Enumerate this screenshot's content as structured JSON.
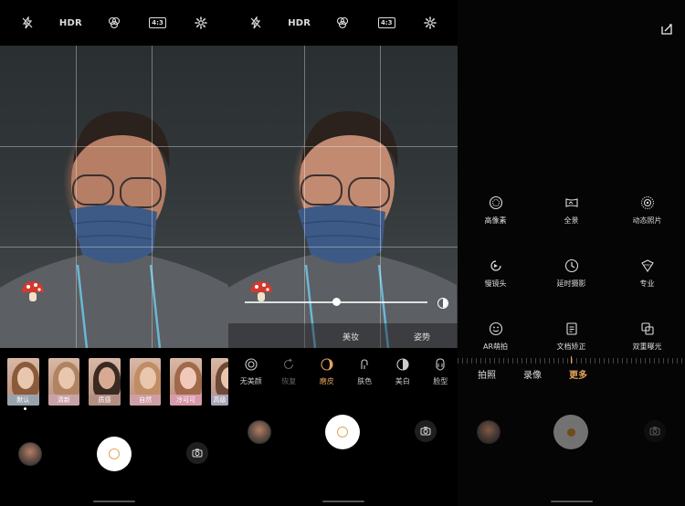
{
  "topbar": {
    "hdr_label": "HDR",
    "ratio_label": "4:3"
  },
  "panel1": {
    "filters": [
      {
        "label": "默认",
        "color": "#9aa3ad"
      },
      {
        "label": "清新",
        "color": "#c9a2a8"
      },
      {
        "label": "质感",
        "color": "#b28f84"
      },
      {
        "label": "自然",
        "color": "#cf9fa6"
      },
      {
        "label": "冷可可",
        "color": "#d79aa9"
      },
      {
        "label": "高级",
        "color": "#a9a4b8"
      }
    ]
  },
  "panel2": {
    "slider_value": 0.5,
    "tabs": [
      "美妆",
      "姿势"
    ],
    "items": [
      {
        "label": "无美颜",
        "state": "normal"
      },
      {
        "label": "恢复",
        "state": "dim"
      },
      {
        "label": "磨皮",
        "state": "active"
      },
      {
        "label": "肤色",
        "state": "normal"
      },
      {
        "label": "美白",
        "state": "normal"
      },
      {
        "label": "脸型",
        "state": "normal"
      }
    ]
  },
  "panel3": {
    "modes": [
      {
        "label": "高像素",
        "icon": "high-pixel-icon"
      },
      {
        "label": "全景",
        "icon": "panorama-icon"
      },
      {
        "label": "动态照片",
        "icon": "live-photo-icon"
      },
      {
        "label": "慢镜头",
        "icon": "slow-motion-icon"
      },
      {
        "label": "延时摄影",
        "icon": "timelapse-icon"
      },
      {
        "label": "专业",
        "icon": "pro-icon"
      },
      {
        "label": "AR萌拍",
        "icon": "ar-smile-icon"
      },
      {
        "label": "文档矫正",
        "icon": "document-icon"
      },
      {
        "label": "双重曝光",
        "icon": "double-exposure-icon"
      }
    ],
    "mode_tabs": [
      "拍照",
      "录像",
      "更多"
    ],
    "active_tab": "更多"
  },
  "colors": {
    "accent": "#e3a35c"
  }
}
